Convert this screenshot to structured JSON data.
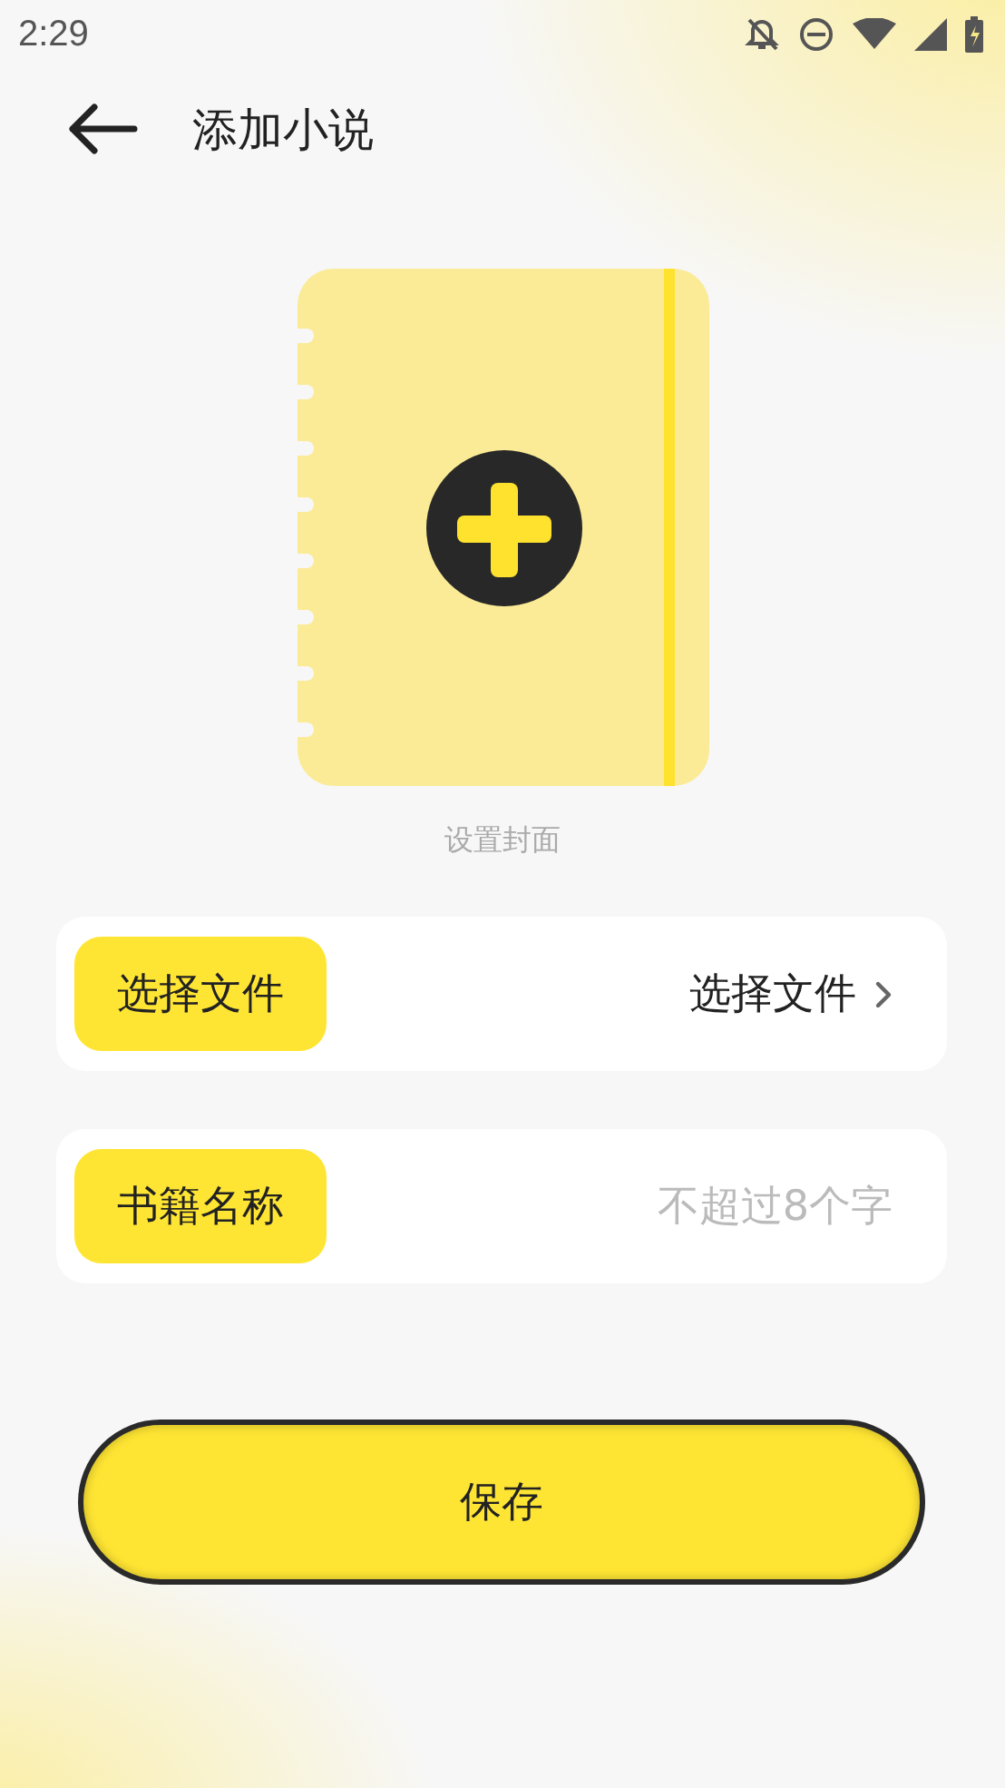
{
  "status_bar": {
    "time": "2:29"
  },
  "header": {
    "title": "添加小说"
  },
  "cover": {
    "caption": "设置封面"
  },
  "rows": [
    {
      "kind": "picker",
      "label": "选择文件",
      "value": "选择文件"
    },
    {
      "kind": "input",
      "label": "书籍名称",
      "placeholder": "不超过8个字"
    }
  ],
  "save_button": {
    "label": "保存"
  }
}
